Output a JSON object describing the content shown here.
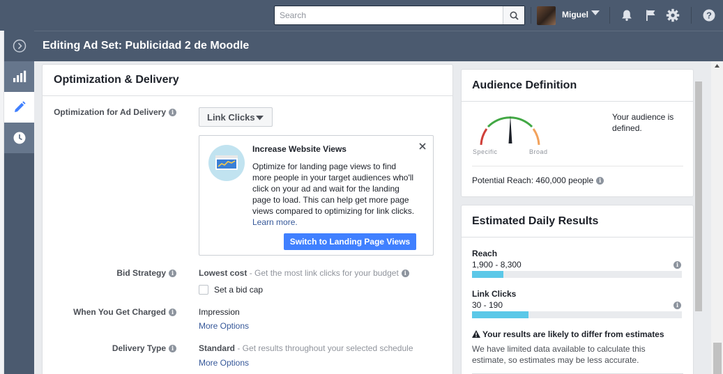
{
  "topbar": {
    "search_placeholder": "Search",
    "user_name": "Miguel",
    "icons": [
      "search-icon",
      "chevron-down-icon",
      "bell-icon",
      "flag-icon",
      "gear-icon",
      "help-icon"
    ]
  },
  "rail": {
    "items": [
      {
        "icon": "expand-icon",
        "active": false
      },
      {
        "icon": "bar-chart-icon",
        "active": false
      },
      {
        "icon": "pencil-icon",
        "active": true
      },
      {
        "icon": "clock-icon",
        "active": false
      }
    ]
  },
  "header": {
    "title": "Editing Ad Set: Publicidad 2 de Moodle"
  },
  "optimization": {
    "title": "Optimization & Delivery",
    "ad_delivery": {
      "label": "Optimization for Ad Delivery",
      "value": "Link Clicks"
    },
    "tip": {
      "title": "Increase Website Views",
      "body": "Optimize for landing page views to find more people in your target audiences who'll click on your ad and wait for the landing page to load. This can help get more page views compared to optimizing for link clicks.",
      "link": "Learn more.",
      "button": "Switch to Landing Page Views"
    },
    "bid_strategy": {
      "label": "Bid Strategy",
      "value": "Lowest cost",
      "desc": " - Get the most link clicks for your budget",
      "checkbox_label": "Set a bid cap",
      "checked": false
    },
    "charged": {
      "label": "When You Get Charged",
      "value": "Impression",
      "more": "More Options"
    },
    "delivery_type": {
      "label": "Delivery Type",
      "value": "Standard",
      "desc": " - Get results throughout your selected schedule",
      "more": "More Options"
    }
  },
  "audience": {
    "title": "Audience Definition",
    "gauge_left": "Specific",
    "gauge_right": "Broad",
    "status": "Your audience is defined.",
    "reach": "Potential Reach: 460,000 people"
  },
  "estimates": {
    "title": "Estimated Daily Results",
    "metrics": [
      {
        "label": "Reach",
        "range": "1,900 - 8,300",
        "fill_fraction": 0.15
      },
      {
        "label": "Link Clicks",
        "range": "30 - 190",
        "fill_fraction": 0.27
      }
    ],
    "warning_title": "Your results are likely to differ from estimates",
    "warning_body": "We have limited data available to calculate this estimate, so estimates may be less accurate."
  },
  "colors": {
    "topbar": "#4b5a6f",
    "accent": "#4080ff",
    "link": "#365899",
    "bar_fill": "#5bc8e8",
    "gauge_green": "#42a844",
    "gauge_red": "#d0403a",
    "gauge_orange": "#f2a25c"
  }
}
